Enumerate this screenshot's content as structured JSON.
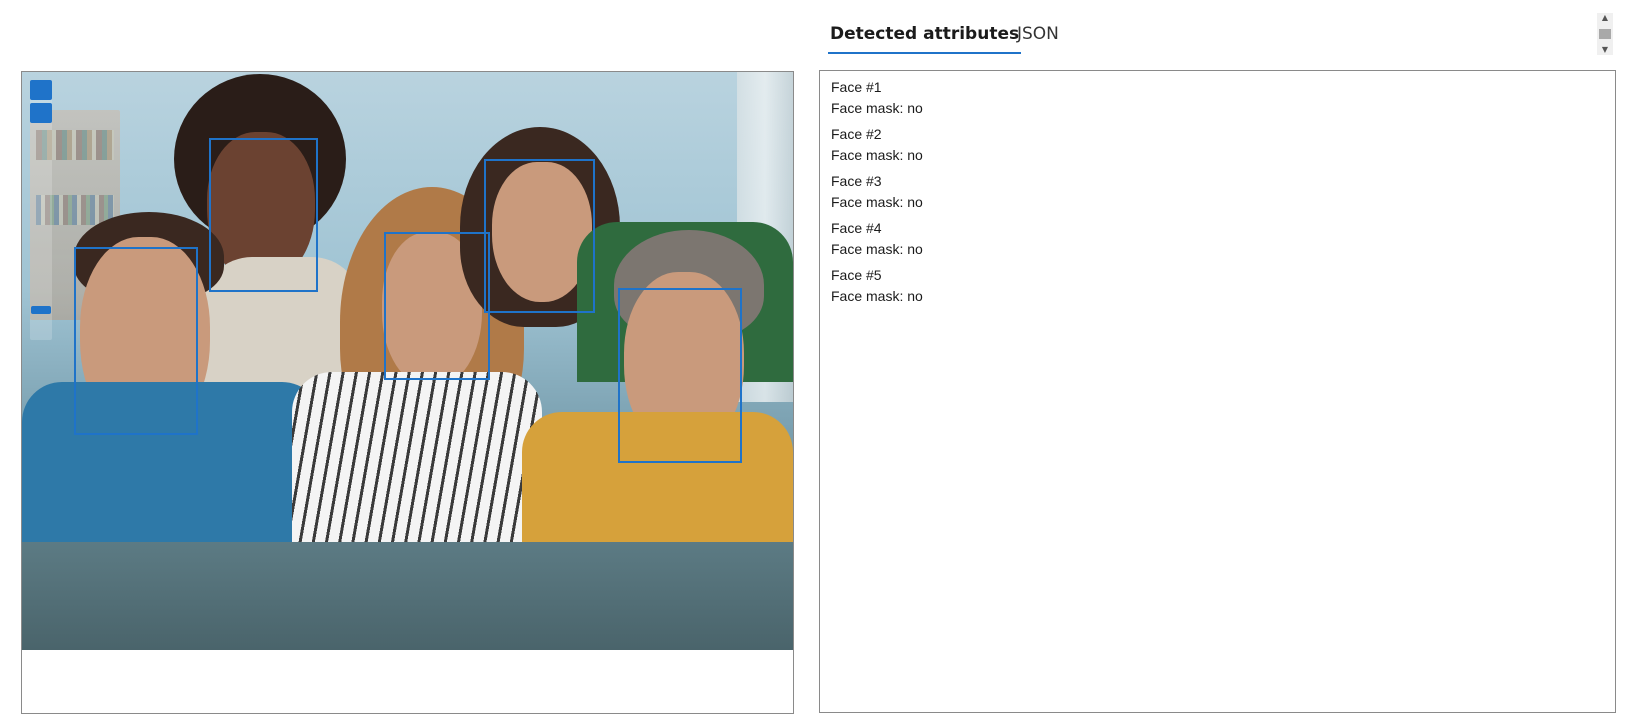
{
  "tabs": [
    {
      "label": "Detected attributes",
      "active": true
    },
    {
      "label": "JSON",
      "active": false
    }
  ],
  "faces": [
    {
      "title": "Face #1",
      "attribute": "Face mask: no"
    },
    {
      "title": "Face #2",
      "attribute": "Face mask: no"
    },
    {
      "title": "Face #3",
      "attribute": "Face mask: no"
    },
    {
      "title": "Face #4",
      "attribute": "Face mask: no"
    },
    {
      "title": "Face #5",
      "attribute": "Face mask: no"
    }
  ],
  "colors": {
    "accent": "#1f73c9",
    "border": "#8a8a8a"
  },
  "icons": {
    "zoom_in": "plus-icon",
    "zoom_out": "minus-icon"
  }
}
